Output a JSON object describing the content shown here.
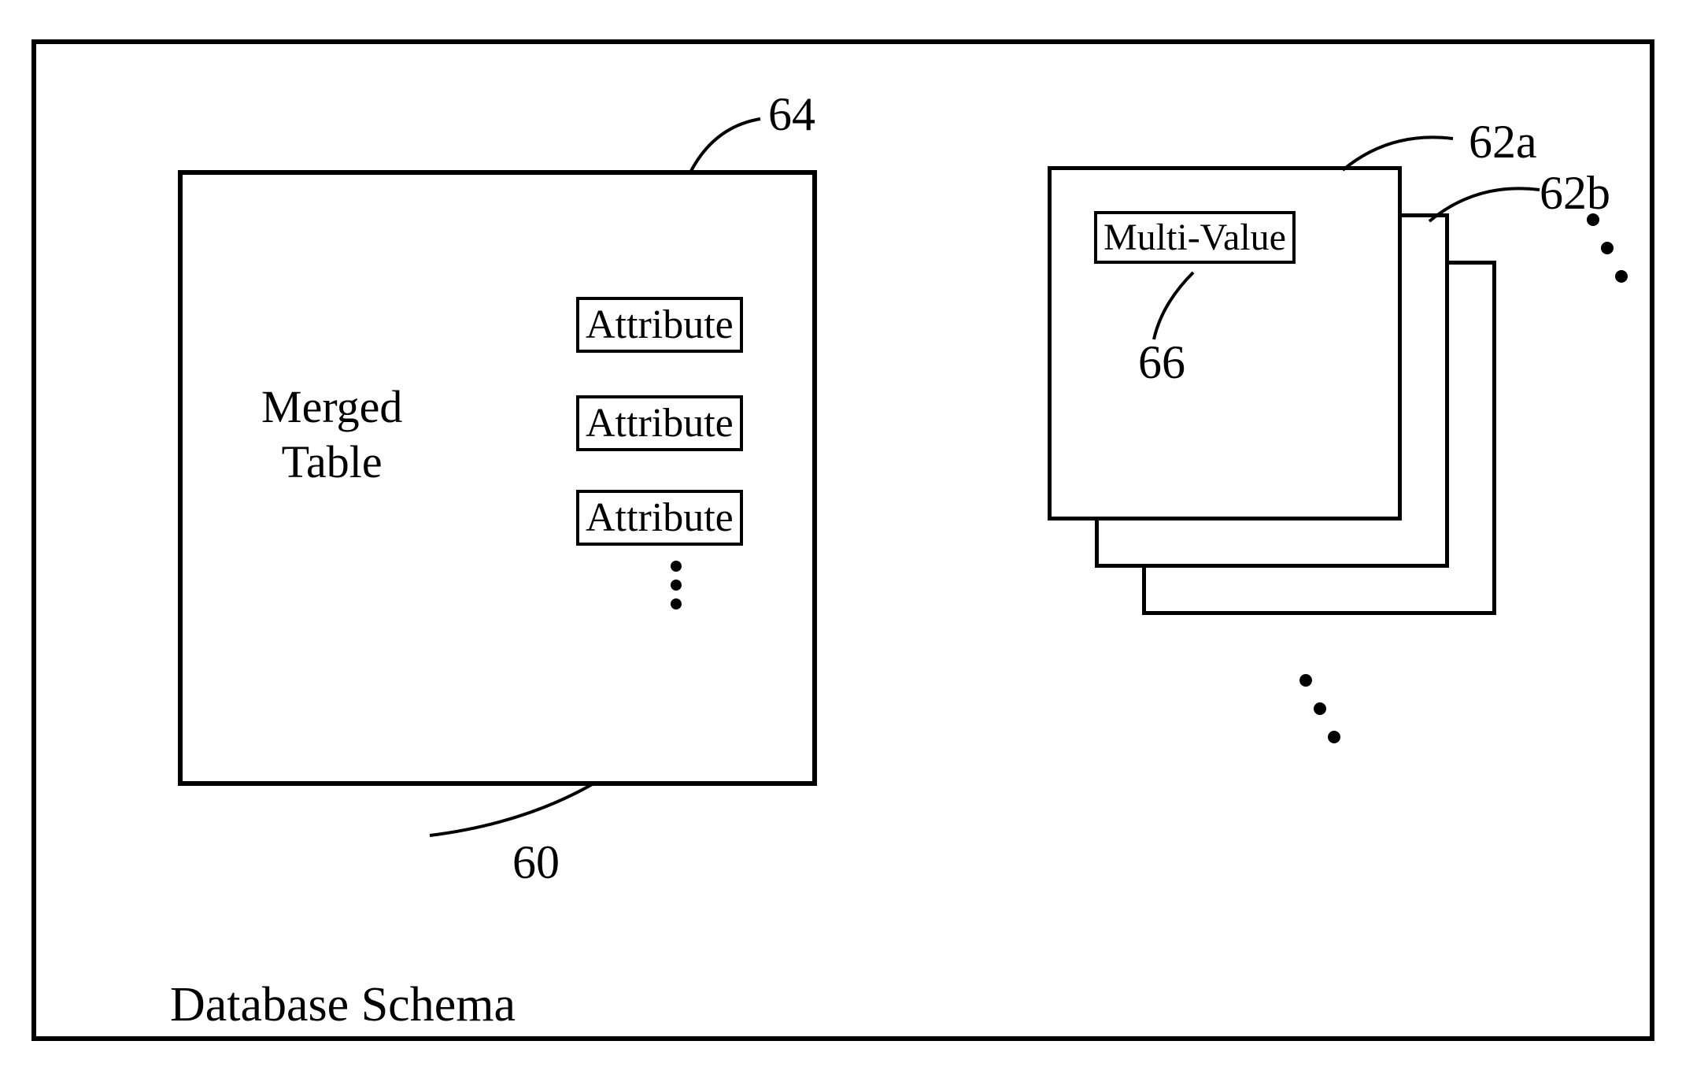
{
  "frame": {
    "title": "Database Schema"
  },
  "mergedTable": {
    "label": "Merged\nTable",
    "callout": "60",
    "attributes": {
      "items": [
        "Attribute",
        "Attribute",
        "Attribute"
      ],
      "callout": "64"
    }
  },
  "multiValue": {
    "label": "Multi-Value",
    "callout_inner": "66",
    "callout_a": "62a",
    "callout_b": "62b"
  }
}
